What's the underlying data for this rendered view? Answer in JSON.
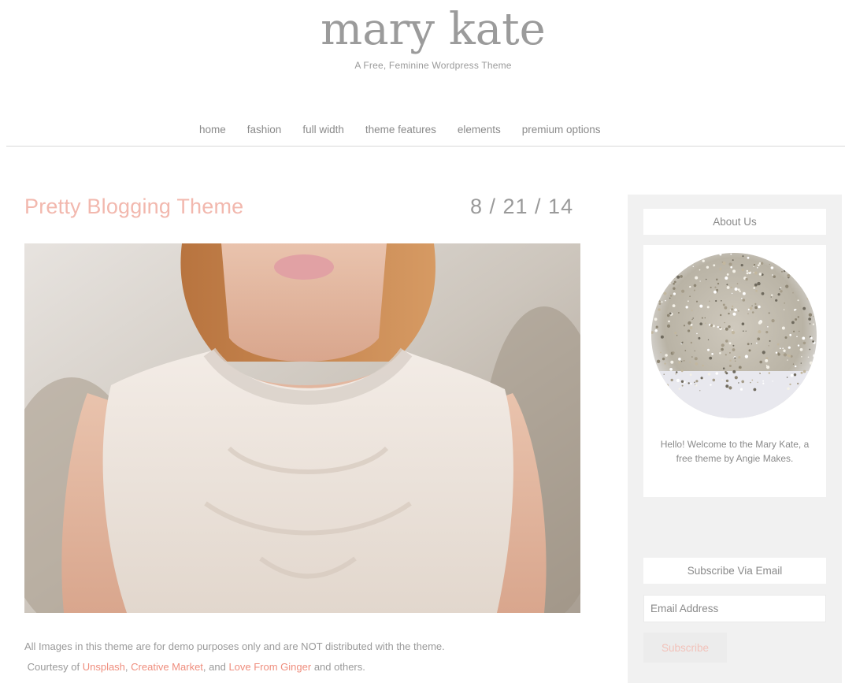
{
  "header": {
    "site_title": "mary kate",
    "tagline": "A Free, Feminine Wordpress Theme"
  },
  "nav": {
    "items": [
      {
        "label": "home"
      },
      {
        "label": "fashion"
      },
      {
        "label": "full width"
      },
      {
        "label": "theme features"
      },
      {
        "label": "elements"
      },
      {
        "label": "premium options"
      }
    ]
  },
  "post": {
    "title": "Pretty Blogging Theme",
    "date": "8 / 21 / 14",
    "body_line1": "All Images in this theme are for demo purposes only and are NOT distributed with the theme.",
    "body_prefix": "Courtesy of ",
    "link_unsplash": "Unsplash",
    "sep1": ", ",
    "link_creative_market": "Creative Market",
    "sep2": ", and ",
    "link_love_from_ginger": "Love From Ginger",
    "body_suffix": " and others."
  },
  "sidebar": {
    "about_title": "About Us",
    "about_text": "Hello! Welcome to the Mary Kate, a free theme by Angie Makes.",
    "subscribe_title": "Subscribe Via Email",
    "email_placeholder": "Email Address",
    "subscribe_button": "Subscribe"
  },
  "colors": {
    "accent_pink": "#f2b8ae",
    "link_pink": "#ef8e7e",
    "sidebar_bg": "#f1f1f1"
  }
}
